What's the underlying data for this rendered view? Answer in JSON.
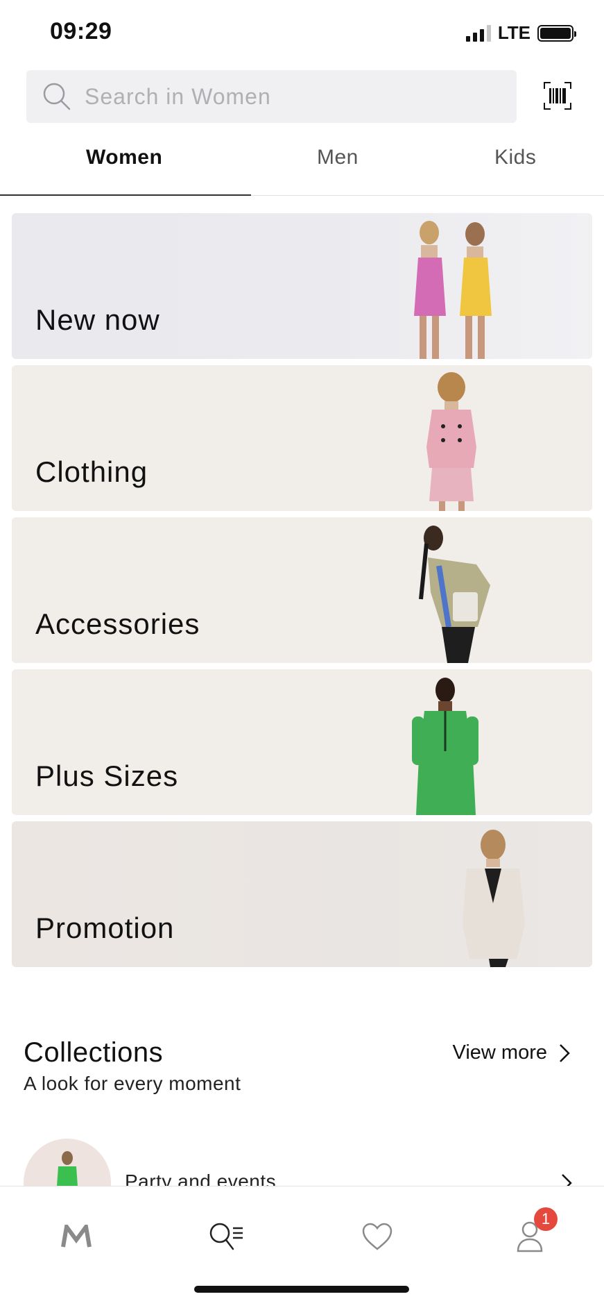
{
  "status_bar": {
    "time": "09:29",
    "network": "LTE"
  },
  "search": {
    "placeholder": "Search in Women"
  },
  "tabs": [
    {
      "label": "Women",
      "active": true
    },
    {
      "label": "Men",
      "active": false
    },
    {
      "label": "Kids",
      "active": false
    }
  ],
  "categories": [
    {
      "label": "New now",
      "background": "#e8e8ed"
    },
    {
      "label": "Clothing",
      "background": "#f1ede8"
    },
    {
      "label": "Accessories",
      "background": "#f1ede8"
    },
    {
      "label": "Plus Sizes",
      "background": "#f1ede8"
    },
    {
      "label": "Promotion",
      "background": "#ece7e4"
    }
  ],
  "collections": {
    "title": "Collections",
    "subtitle": "A look for every moment",
    "view_more": "View more",
    "items": [
      {
        "label": "Party and events"
      }
    ]
  },
  "bottom_nav": {
    "items": [
      {
        "name": "home",
        "icon": "mango-logo-icon"
      },
      {
        "name": "search",
        "icon": "search-menu-icon"
      },
      {
        "name": "favorites",
        "icon": "heart-icon"
      },
      {
        "name": "account",
        "icon": "user-icon"
      }
    ],
    "account_badge": "1"
  },
  "colors": {
    "badge": "#e5483d",
    "text": "#111111",
    "search_bg": "#f0f0f2"
  }
}
